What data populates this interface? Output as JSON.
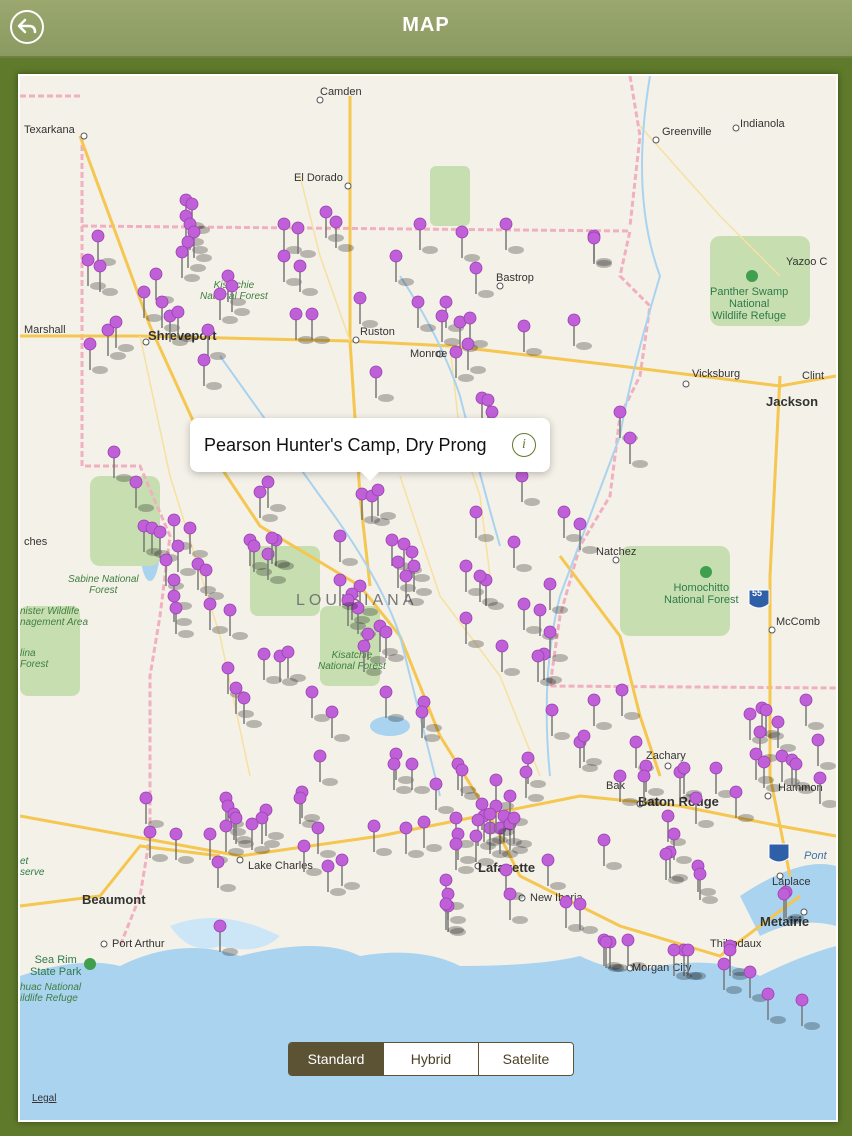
{
  "header": {
    "title": "MAP"
  },
  "callout": {
    "text": "Pearson Hunter's Camp, Dry Prong"
  },
  "map_type": {
    "options": [
      "Standard",
      "Hybrid",
      "Satelite"
    ],
    "selected": "Standard"
  },
  "legal": "Legal",
  "places": {
    "camden": "Camden",
    "texarkana": "Texarkana",
    "el_dorado": "El Dorado",
    "greenville": "Greenville",
    "indianola": "Indianola",
    "bastrop": "Bastrop",
    "yazoo": "Yazoo C",
    "marshall": "Marshall",
    "shreveport": "Shreveport",
    "ruston": "Ruston",
    "monroe": "Monroe",
    "vicksburg": "Vicksburg",
    "clint": "Clint",
    "jackson": "Jackson",
    "ches": "ches",
    "natchez": "Natchez",
    "mccomb": "McComb",
    "zachary": "Zachary",
    "baker": "Bak",
    "baton_rouge": "Baton Rouge",
    "hammond": "Hammon",
    "lake_charles": "Lake Charles",
    "lafayette": "Lafayette",
    "new_iberia": "New Iberia",
    "laplace": "Laplace",
    "pont": "Pont",
    "beaumont": "Beaumont",
    "port_arthur": "Port Arthur",
    "thibodaux": "Thibodaux",
    "morgan_city": "Morgan City",
    "metairie": "Metairie",
    "sea_rim": "Sea Rim\nState Park",
    "louisiana": "LOUISIANA",
    "interstate_55": "55",
    "et_serve": "et\nserve"
  },
  "parks": {
    "kisatchie_north": "Kisatchie\nNational Forest",
    "panther": "Panther Swamp\nNational\nWildlife Refuge",
    "sabine": "Sabine National\nForest",
    "homochitto": "Homochitto\nNational Forest",
    "kisatchie_south": "Kisatchie\nNational Forest",
    "nister": "nister Wildlife\nnagement Area",
    "lina": "lina\nForest",
    "huac": "huac National\nildlife Refuge"
  },
  "colors": {
    "pin": "#c060d8",
    "water": "#a9d3ef",
    "land": "#f4f1e8",
    "forest": "#c7dfb0",
    "accent": "#5e7a2a"
  }
}
